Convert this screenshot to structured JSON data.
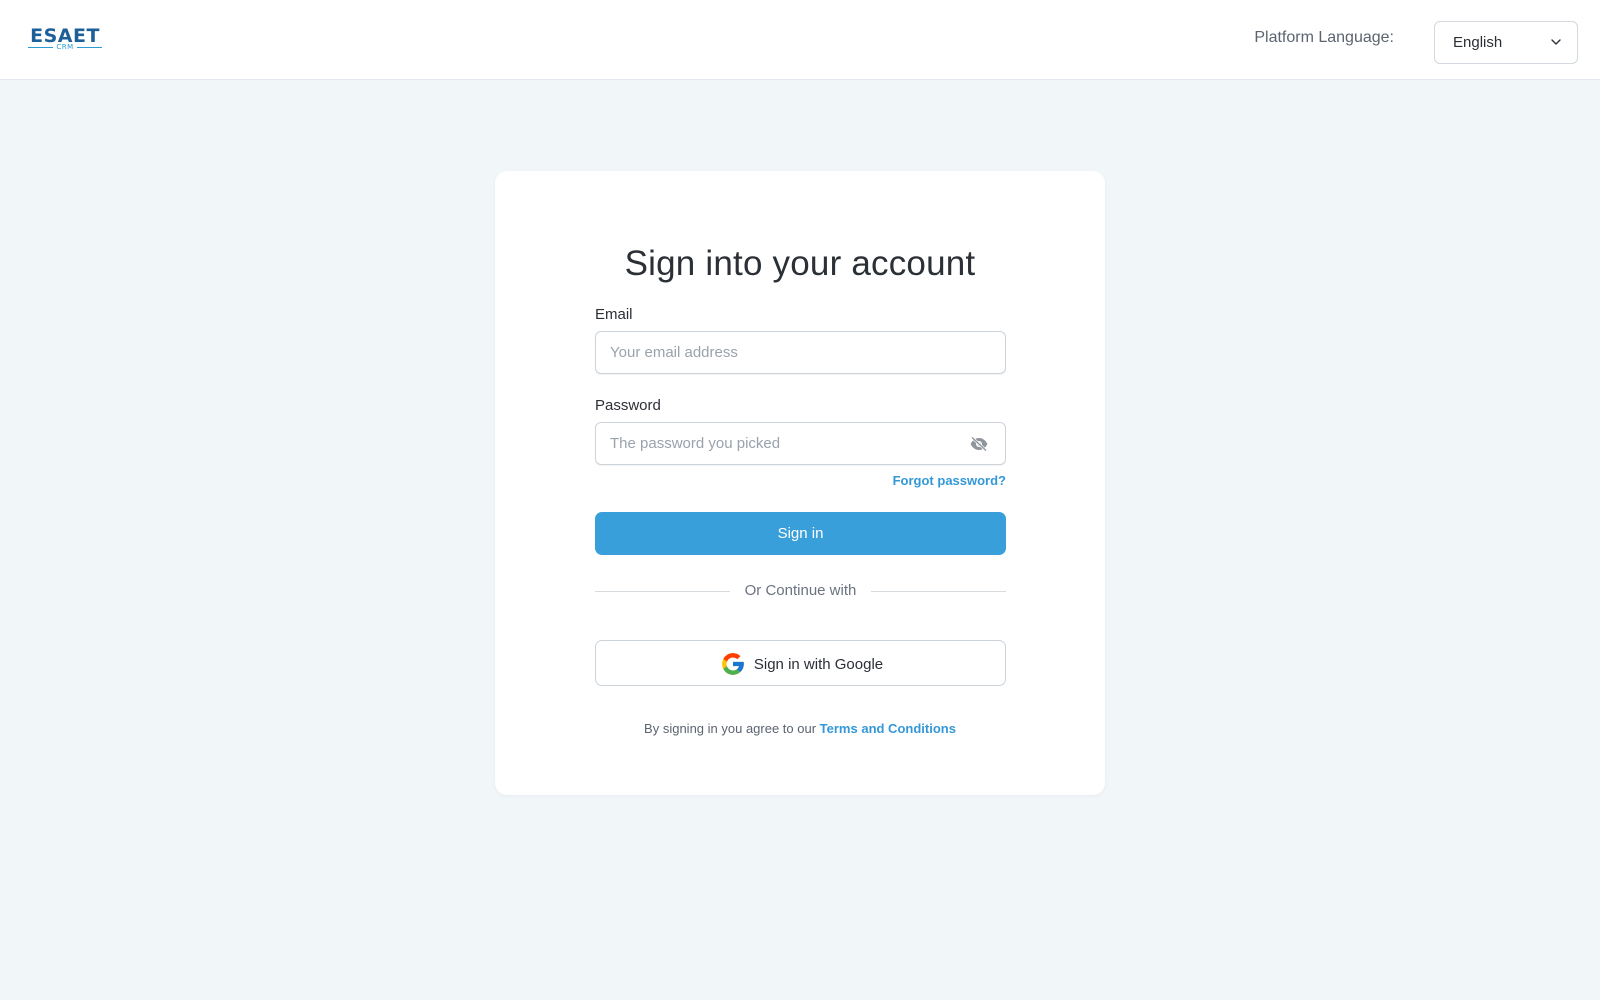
{
  "header": {
    "logo_text": "ESAET",
    "logo_sub": "CRM",
    "language_label": "Platform Language:",
    "language_value": "English"
  },
  "card": {
    "title": "Sign into your account",
    "email_label": "Email",
    "email_placeholder": "Your email address",
    "password_label": "Password",
    "password_placeholder": "The password you picked",
    "forgot_link": "Forgot password?",
    "signin_button": "Sign in",
    "divider_text": "Or Continue with",
    "google_button": "Sign in with Google",
    "terms_prefix": "By signing in you agree to our",
    "terms_link": "Terms and Conditions"
  },
  "colors": {
    "accent": "#399fdb",
    "link": "#3498d8",
    "logo": "#1d5f98",
    "background": "#f1f6f9"
  },
  "icons": {
    "chevron": "chevron-down-icon",
    "eye": "eye-icon",
    "google": "google-icon"
  }
}
